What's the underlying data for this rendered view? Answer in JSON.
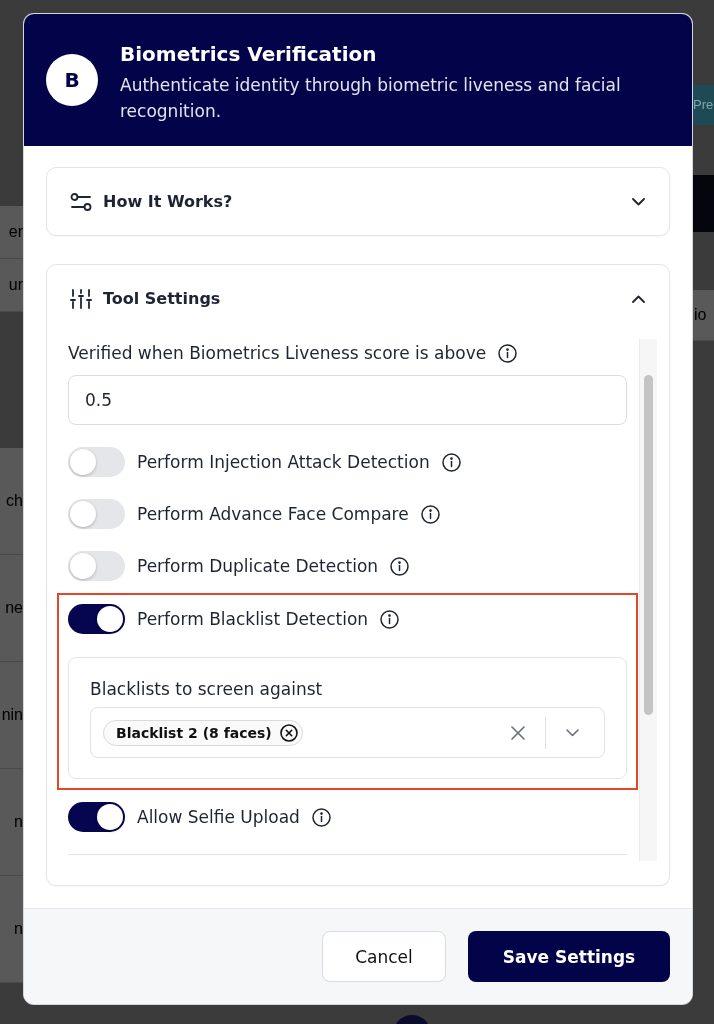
{
  "background": {
    "left_fragments": [
      "er",
      "ur",
      "ch",
      "ne",
      "nin",
      "n",
      "n"
    ],
    "right_button": "Pre",
    "right_fragment": "io"
  },
  "dialog": {
    "avatar": "B",
    "title": "Biometrics Verification",
    "subtitle": "Authenticate identity through biometric liveness and facial recognition."
  },
  "sections": [
    {
      "title": "How It Works?",
      "expanded": false
    },
    {
      "title": "Tool Settings",
      "expanded": true,
      "score_field": {
        "label": "Verified when Biometrics Liveness score is above",
        "value": "0.5"
      },
      "settings": [
        {
          "label": "Perform Injection Attack Detection",
          "on": false,
          "highlighted": false
        },
        {
          "label": "Perform Advance Face Compare",
          "on": false,
          "highlighted": false
        },
        {
          "label": "Perform Duplicate Detection",
          "on": false,
          "highlighted": false
        },
        {
          "label": "Perform Blacklist Detection",
          "on": true,
          "highlighted": true,
          "blacklists": {
            "label": "Blacklists to screen against",
            "tags": [
              "Blacklist 2 (8 faces)"
            ]
          }
        },
        {
          "label": "Allow Selfie Upload",
          "on": true,
          "highlighted": false
        }
      ]
    }
  ],
  "buttons": [
    {
      "label": "Cancel",
      "kind": "secondary"
    },
    {
      "label": "Save Settings",
      "kind": "primary"
    }
  ]
}
